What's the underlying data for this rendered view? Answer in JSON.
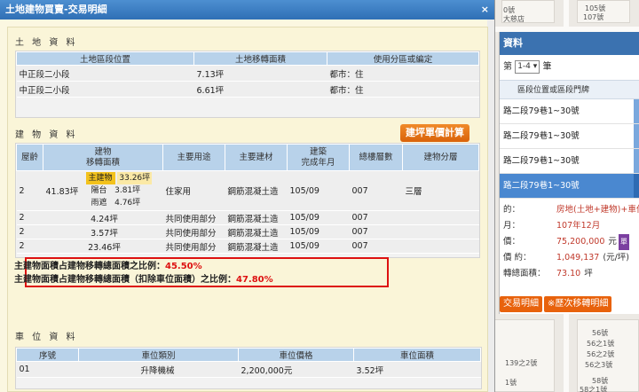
{
  "modal": {
    "title": "土地建物買賣-交易明細",
    "close_label": "×"
  },
  "land": {
    "section_title": "土 地 資 料",
    "columns": [
      "土地區段位置",
      "土地移轉面積",
      "使用分區或編定"
    ],
    "rows": [
      [
        "中正段二小段",
        "7.13坪",
        "都市：住"
      ],
      [
        "中正段二小段",
        "6.61坪",
        "都市：住"
      ]
    ]
  },
  "calc_button": "建坪單價計算",
  "building": {
    "section_title": "建 物 資 料",
    "col_age": "屋齡",
    "col_area": [
      "建物",
      "移轉面積"
    ],
    "col_use": "主要用途",
    "col_material": "主要建材",
    "col_built": [
      "建築",
      "完成年月"
    ],
    "col_floors": "總樓層數",
    "col_level": "建物分層",
    "main_row": {
      "age": "2",
      "area": "41.83坪",
      "sub": [
        {
          "label": "主建物",
          "value": "33.26坪"
        },
        {
          "label": "陽台",
          "value": "3.81坪"
        },
        {
          "label": "雨遮",
          "value": "4.76坪"
        }
      ],
      "use": "住家用",
      "material": "鋼筋混凝土造",
      "built": "105/09",
      "floors": "007",
      "level": "三層"
    },
    "rows": [
      {
        "age": "2",
        "area": "4.24坪",
        "use": "共同使用部分",
        "material": "鋼筋混凝土造",
        "built": "105/09",
        "floors": "007",
        "level": ""
      },
      {
        "age": "2",
        "area": "3.57坪",
        "use": "共同使用部分",
        "material": "鋼筋混凝土造",
        "built": "105/09",
        "floors": "007",
        "level": ""
      },
      {
        "age": "2",
        "area": "23.46坪",
        "use": "共同使用部分",
        "material": "鋼筋混凝土造",
        "built": "105/09",
        "floors": "007",
        "level": ""
      }
    ]
  },
  "ratios": {
    "line1_label": "主建物面積占建物移轉總面積之比例：",
    "line1_value": "45.50%",
    "line2_label": "主建物面積占建物移轉總面積（扣除車位面積）之比例：",
    "line2_value": "47.80%"
  },
  "parking": {
    "section_title": "車 位 資 料",
    "columns": [
      "序號",
      "車位類別",
      "車位價格",
      "車位面積"
    ],
    "rows": [
      [
        "01",
        "升降機械",
        "2,200,000元",
        "3.52坪"
      ]
    ]
  },
  "side": {
    "header": "資料",
    "pager_prefix": "第",
    "pager_value": "1-4 ▾",
    "pager_suffix": "筆",
    "col_header": "區段位置或區段門牌",
    "rows": [
      "路二段79巷1~30號",
      "路二段79巷1~30號",
      "路二段79巷1~30號",
      "路二段79巷1~30號"
    ],
    "active_index": 3,
    "detail": [
      {
        "k": "的：",
        "v": "房地(土地+建物)+車位"
      },
      {
        "k": "月：",
        "v": "107年12月"
      },
      {
        "k": "價：",
        "v": "75,200,000",
        "u": "元",
        "tag": "單"
      },
      {
        "k": "價 約：",
        "v": "1,049,137",
        "u": "(元/坪)"
      },
      {
        "k": "轉總面積：",
        "v": "73.10",
        "u": "坪"
      }
    ],
    "btn_detail": "交易明細",
    "btn_history": "※歷次移轉明細"
  },
  "map_labels": [
    "0號",
    "105號",
    "107號",
    "大慈店",
    "56號",
    "56之1號",
    "56之2號",
    "56之3號",
    "139之2號",
    "58號",
    "1號",
    "58之1號"
  ]
}
